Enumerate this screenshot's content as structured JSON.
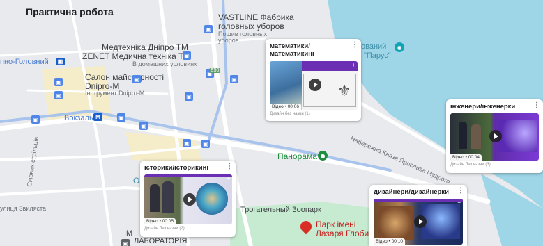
{
  "title": "Практична робота",
  "map": {
    "labels": {
      "vastline": "VASTLINE Фабрика",
      "vastline2": "головных уборов",
      "vastline3": "Пошив головных",
      "vastline4": "уборов",
      "medtech": "Медтехніка Дніпро ТМ",
      "zenet": "ZENET Медична техніка Т...",
      "zenet_sub": "В домашних условиях",
      "salon": "Салон майстерності",
      "salon2": "Dnipro-M",
      "salon_sub": "Інструмент Dnipro-M",
      "station_left": "пно-Головний",
      "vokzalna": "Вокзальна",
      "parus": "ований",
      "parus2": "\"Парус\"",
      "panorama": "Панорама",
      "street_yaroslav": "Набережна Князя Ярослава Мудрого",
      "street_sichovyh": "Січових стрільців",
      "street_ziv": "улиця Звиляста",
      "zoo": "Трогательный Зоопарк",
      "park": "Парк імені",
      "park2": "Лазаря Глоби",
      "lab": "ЛАБОРАТОРІЯ",
      "e50": "E50",
      "os": "Ос",
      "im": "ІМ"
    },
    "colors": {
      "water": "#9ed6e8",
      "park": "#c6ebd0",
      "road": "#ffffff",
      "highway": "#a9c4ec"
    }
  },
  "cards": [
    {
      "title": "математики/ математикині",
      "duration": "Відео • 00:06",
      "caption": "Дизайн без назви (1)"
    },
    {
      "title": "інженери/інженерки",
      "duration": "Відео • 00:04",
      "caption": "Дизайн без назви (3)"
    },
    {
      "title": "історики/історикині",
      "duration": "Відео • 00:05",
      "caption": "Дизайн без назви (2)"
    },
    {
      "title": "дизайнери/дизайнерки",
      "duration": "Відео • 00:10",
      "caption": ""
    }
  ]
}
